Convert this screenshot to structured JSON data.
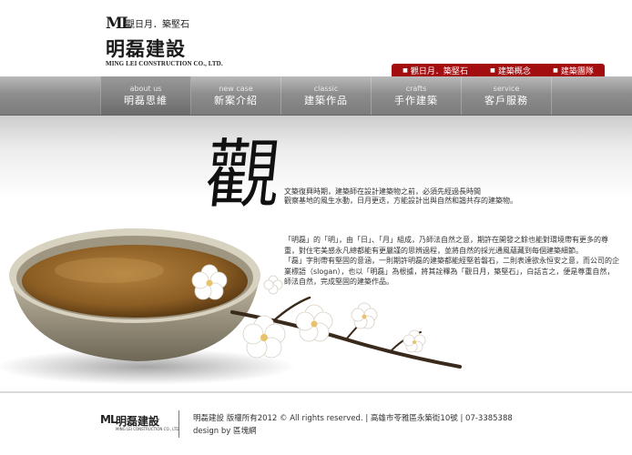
{
  "header": {
    "logo_ml": "ML",
    "slogan": "觀日月．築堅石",
    "company_cn": "明磊建設",
    "company_en": "MING LEI CONSTRUCTION CO., LTD."
  },
  "topbar": {
    "items": [
      {
        "label": "觀日月．築堅石"
      },
      {
        "label": "建築概念"
      },
      {
        "label": "建築團隊"
      }
    ],
    "background": "#a40d10"
  },
  "nav": {
    "items": [
      {
        "en": "about us",
        "cn": "明磊思維",
        "active": true
      },
      {
        "en": "new case",
        "cn": "新案介紹",
        "active": false
      },
      {
        "en": "classic",
        "cn": "建築作品",
        "active": false
      },
      {
        "en": "crafts",
        "cn": "手作建築",
        "active": false
      },
      {
        "en": "service",
        "cn": "客戶服務",
        "active": false
      }
    ]
  },
  "content": {
    "kanji": "觀",
    "intro": [
      "文築復興時期，建築師在設計建築物之前，必須先經過長時間",
      "觀察基地的風生水動，日月更迭，方能設計出與自然和諧共存的建築物。"
    ],
    "body": [
      "「明磊」的「明」，由「日」、「月」組成，乃師法自然之意，期許在開發之餘也能對環境帶有更多的尊重，對住宅美感永凡總都能有更嚴謹的思辨過程，並將自然的採光通風蘊藏到每個建築細節。",
      "「磊」字則帶有堅固的意涵，一則期許明磊的建築都能經堅若磐石，二則表達欲永恒安之意，而公司的企業標語（slogan），也以「明磊」為根據，將其詮釋為「觀日月，築堅石」，白話言之，便是尊重自然，師法自然，完成堅固的建築作品。"
    ]
  },
  "footer": {
    "logo_ml": "ML",
    "logo_cn": "明磊建設",
    "logo_en": "MING LEI CONSTRUCTION CO., LTD.",
    "copyright": "明磊建設 版權所有2012 © All rights reserved.",
    "address": "高雄市苓雅區永築街10號",
    "phone": "07-3385388",
    "design_prefix": "design by",
    "design_by": "區塊網"
  }
}
